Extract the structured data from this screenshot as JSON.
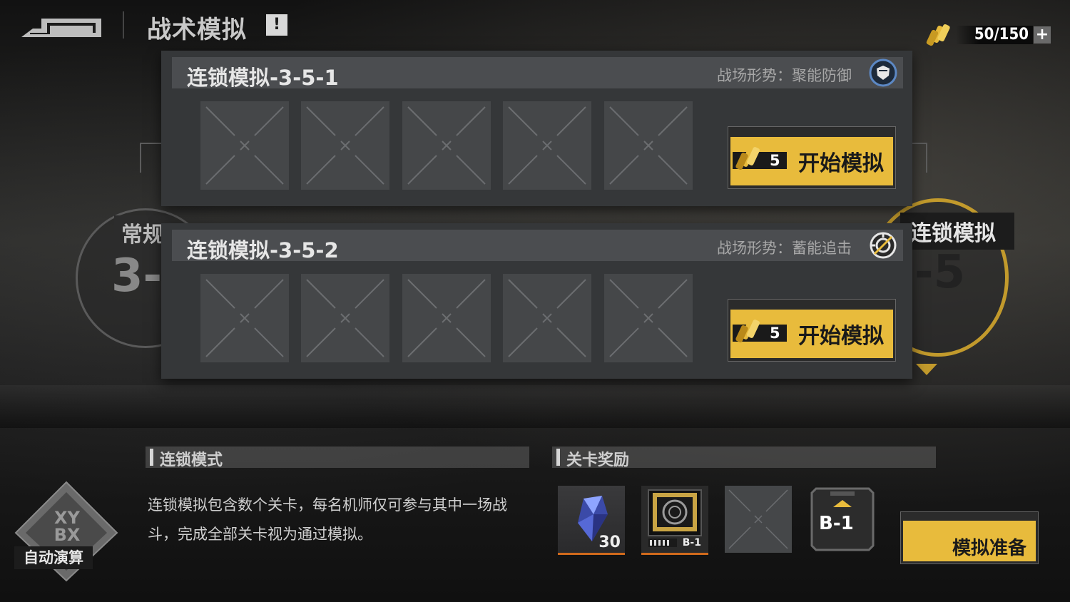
{
  "header": {
    "title": "战术模拟",
    "info_label": "!",
    "energy": "50/150",
    "energy_add": "+"
  },
  "background": {
    "left_stage_tag": "常规",
    "left_stage_num": "3-",
    "right_stage_tag": "连锁模拟",
    "right_stage_num": "-5"
  },
  "panels": [
    {
      "title": "连锁模拟-3-5-1",
      "situation": "战场形势：聚能防御",
      "situation_icon": "shield-icon",
      "slots": 5,
      "start_label": "开始模拟",
      "cost": "5"
    },
    {
      "title": "连锁模拟-3-5-2",
      "situation": "战场形势：蓄能追击",
      "situation_icon": "crosshair-icon",
      "slots": 5,
      "start_label": "开始模拟",
      "cost": "5"
    }
  ],
  "mode": {
    "heading": "连锁模式",
    "description": "连锁模拟包含数个关卡，每名机师仅可参与其中一场战斗，完成全部关卡视为通过模拟。"
  },
  "rewards": {
    "heading": "关卡奖励",
    "items": [
      {
        "icon": "crystal-icon",
        "count": "30"
      },
      {
        "icon": "chip-icon",
        "label": "B-1"
      },
      {
        "icon": "empty-slot-icon"
      },
      {
        "icon": "b-chip-icon",
        "label": "B-1"
      }
    ]
  },
  "auto": {
    "logo": "XY\nBX",
    "label": "自动演算"
  },
  "prepare_label": "模拟准备",
  "colors": {
    "accent": "#e8bb3c",
    "panel": "#353739",
    "reward_line": "#d16a1c"
  }
}
